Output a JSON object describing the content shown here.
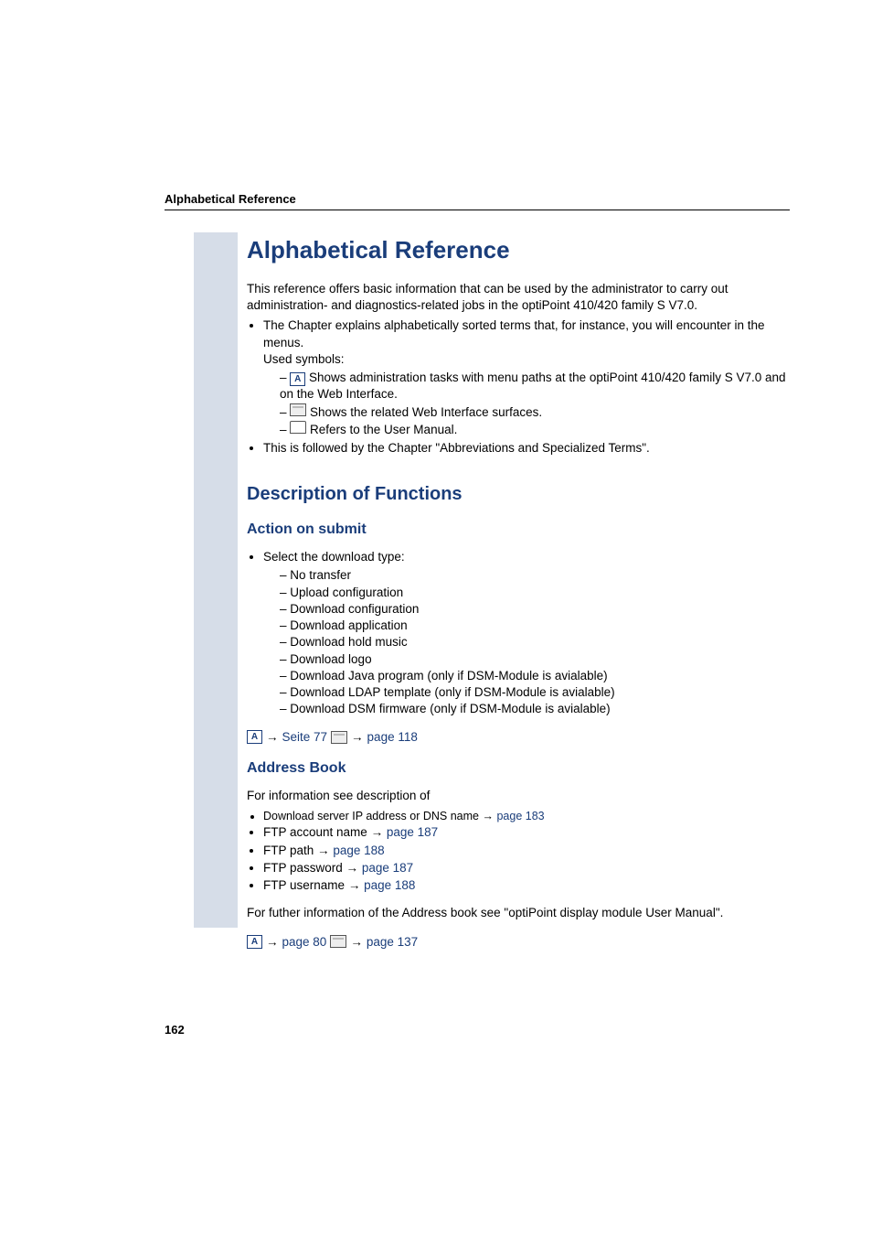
{
  "header": "Alphabetical Reference",
  "title": "Alphabetical Reference",
  "intro": "This reference offers basic information that can be used by the administrator to carry out administration- and diagnostics-related jobs in the optiPoint 410/420 family S V7.0.",
  "intro_bullets": {
    "b1_line1": "The Chapter  explains alphabetically sorted terms that, for instance, you will encounter in the menus.",
    "b1_line2": "Used symbols:",
    "sym1": " Shows administration tasks with menu paths at the optiPoint 410/420 family S V7.0 and on the Web Interface.",
    "sym2": " Shows the related Web Interface surfaces.",
    "sym3": " Refers to the User Manual.",
    "b2": "This is followed by the Chapter \"Abbreviations and Specialized Terms\"."
  },
  "h2_desc": "Description of Functions",
  "h3_action": "Action on submit",
  "action_bullet": "Select the download type:",
  "action_items": {
    "i1": "No transfer",
    "i2": "Upload configuration",
    "i3": "Download configuration",
    "i4": "Download application",
    "i5": "Download hold music",
    "i6": "Download logo",
    "i7": "Download Java program (only if DSM-Module is avialable)",
    "i8": "Download LDAP template (only if DSM-Module is avialable)",
    "i9": "Download DSM firmware (only if DSM-Module is avialable)"
  },
  "action_ref": {
    "r1": "Seite 77",
    "r2": "page 118"
  },
  "h3_address": "Address Book",
  "address_intro": "For information see description of",
  "address_items": {
    "a1_text": "Download server IP address or DNS name",
    "a1_link": "page 183",
    "a2_text": "FTP account name",
    "a2_link": "page 187",
    "a3_text": "FTP path",
    "a3_link": "page 188",
    "a4_text": "FTP password",
    "a4_link": "page 187",
    "a5_text": "FTP username",
    "a5_link": "page 188"
  },
  "address_outro": "For futher information of the Address book see \"optiPoint display module User Manual\".",
  "address_ref": {
    "r1": "page 80",
    "r2": "page 137"
  },
  "arrow": "→",
  "page_number": "162"
}
